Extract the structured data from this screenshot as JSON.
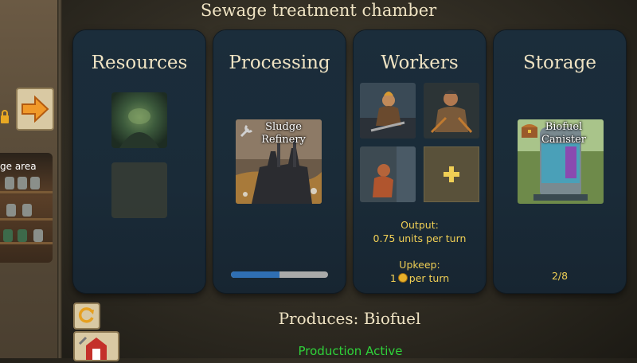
{
  "screen": {
    "title": "Sewage treatment chamber"
  },
  "sidebar": {
    "storage_label": "ge area"
  },
  "panels": {
    "resources": {
      "title": "Resources"
    },
    "processing": {
      "title": "Processing",
      "building_label": "Sludge Refinery",
      "progress": 0.5
    },
    "workers": {
      "title": "Workers",
      "output_label": "Output:",
      "output_value": "0.75 units per turn",
      "upkeep_label": "Upkeep:",
      "upkeep_amount": "1",
      "upkeep_unit": "per turn"
    },
    "storage": {
      "title": "Storage",
      "item_label": "Biofuel Canister",
      "count": "2/8"
    }
  },
  "footer": {
    "produces": "Produces: Biofuel",
    "status": "Production Active"
  },
  "colors": {
    "panel": "#1b2d3b",
    "title": "#efe3c3",
    "accent_yellow": "#f0cf55",
    "status_green": "#2fd23a",
    "progress_fill": "#2f6fb3"
  },
  "icons": [
    "lock-icon",
    "arrow-right-icon",
    "plus-icon",
    "coin-icon",
    "refresh-icon",
    "barn-icon"
  ]
}
